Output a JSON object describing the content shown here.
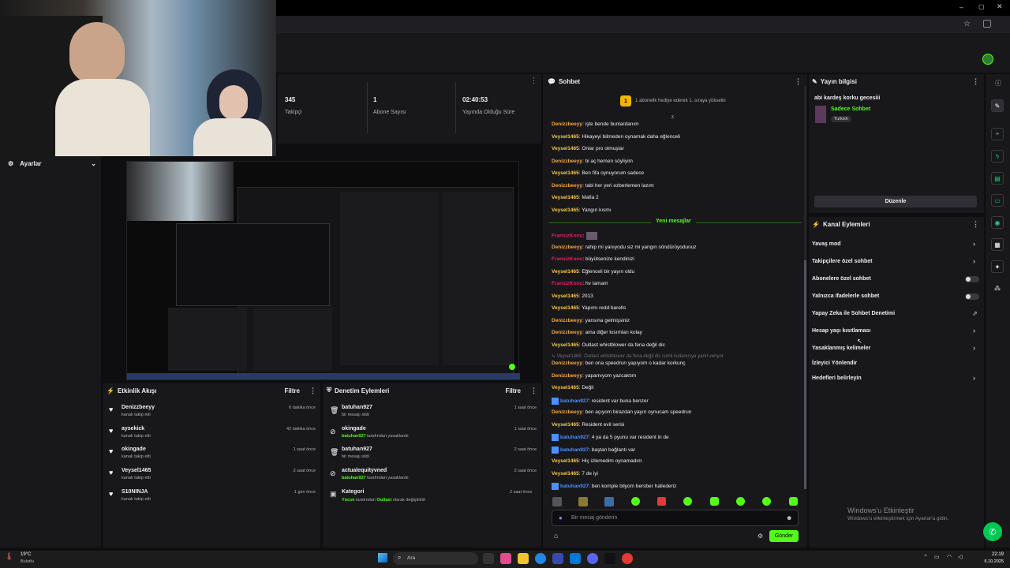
{
  "stats": [
    {
      "value": "345",
      "label": "Takipçi"
    },
    {
      "value": "1",
      "label": "Abone Sayısı"
    },
    {
      "value": "02:40:53",
      "label": "Yayında Olduğu Süre"
    }
  ],
  "left": {
    "settings": "Ayarlar"
  },
  "chat": {
    "title": "Sohbet",
    "goal_badge": "1",
    "goal_text": "1 abonelik hediye ederek 1. sıraya yükselin",
    "new_messages": "Yeni mesajlar",
    "input_placeholder": "Bir mesaj gönderin",
    "send": "Gönder",
    "messages": [
      {
        "user": "Denizzbeeyy",
        "color": "o",
        "text": ": işte bende bunlardanım"
      },
      {
        "user": "Veysel1465",
        "color": "y",
        "text": ": Hikayeyi bilmeden oynamak daha eğlenceli"
      },
      {
        "user": "Veysel1465",
        "color": "y",
        "text": ": Onlar pro olmuşlar"
      },
      {
        "user": "Denizzbeeyy",
        "color": "o",
        "text": ": bi aç hemen söyliyim"
      },
      {
        "user": "Veysel1465",
        "color": "y",
        "text": ": Ben fifa oynuyorum sadece"
      },
      {
        "user": "Denizzbeeyy",
        "color": "o",
        "text": ": tabi her yeri ezberlemen lazım"
      },
      {
        "user": "Veysel1465",
        "color": "y",
        "text": ": Mafia 2"
      },
      {
        "user": "Veysel1465",
        "color": "y",
        "text": ": Yangın kısmı"
      }
    ],
    "messages2": [
      {
        "user": "FransizKonu",
        "color": "p",
        "text": ":"
      },
      {
        "user": "Denizzbeeyy",
        "color": "o",
        "text": ": rahip mi yanıyodu siz mi yangın söndürüyodunuz"
      },
      {
        "user": "FransizKonu",
        "color": "p",
        "text": ": büyütsenize kendinizi"
      },
      {
        "user": "Veysel1465",
        "color": "y",
        "text": ": Eğlenceli bir yayın oldu"
      },
      {
        "user": "FransizKonu",
        "color": "p",
        "text": ": hv tamam"
      },
      {
        "user": "Veysel1465",
        "color": "y",
        "text": ": 2013"
      },
      {
        "user": "Veysel1465",
        "color": "y",
        "text": ": Yapımı redd barells"
      },
      {
        "user": "Denizzbeeyy",
        "color": "o",
        "text": ": yansına gelmişsiniz"
      },
      {
        "user": "Denizzbeeyy",
        "color": "o",
        "text": ": ama diğer kısımları kolay"
      },
      {
        "user": "Veysel1465",
        "color": "y",
        "text": ": Outlast whistblower da fena değil dic"
      }
    ],
    "reply_note": "Veysel1465: Outlast whistblower da fena değil dic isimli kullanıcıya yanıt veriyor",
    "messages3": [
      {
        "user": "Denizzbeeyy",
        "color": "o",
        "text": ": ben ona speedrun yapıyom o kadar korkunç"
      },
      {
        "user": "Denizzbeeyy",
        "color": "o",
        "text": ": yapamıyom yazcaktım"
      },
      {
        "user": "Veysel1465",
        "color": "y",
        "text": ": Değil"
      },
      {
        "user": "batuhan927",
        "color": "b",
        "text": ": resident var buna benzer"
      },
      {
        "user": "Denizzbeeyy",
        "color": "o",
        "text": ": ben açıyom birazdan yayın oynucam speedrun"
      },
      {
        "user": "Veysel1465",
        "color": "y",
        "text": ": Resident evil serisi"
      },
      {
        "user": "batuhan927",
        "color": "b",
        "text": ": 4 ya da 5 pyunu var resident in de"
      },
      {
        "user": "batuhan927",
        "color": "b",
        "text": ": baştan bağlantı var"
      },
      {
        "user": "Veysel1465",
        "color": "y",
        "text": ": Hiç izlemedim oynamadım"
      },
      {
        "user": "Veysel1465",
        "color": "y",
        "text": ": 7 de iyi"
      },
      {
        "user": "batuhan927",
        "color": "b",
        "text": ": ben komple bilyom bersber hallederiz"
      }
    ]
  },
  "stream_info": {
    "title": "Yayın bilgisi",
    "stream_title": "abi kardeş korku gecesiii",
    "category": "Sadece Sohbet",
    "tag": "Turkish",
    "edit": "Düzenle"
  },
  "channel_actions": {
    "title": "Kanal Eylemleri",
    "items": [
      "Yavaş mod",
      "Takipçilere özel sohbet",
      "Abonelere özel sohbet",
      "Yalnızca ifadelerle sohbet",
      "Yapay Zeka ile Sohbet Denetimi",
      "Hesap yaşı kısıtlaması",
      "Yasaklanmış kelimeler",
      "İzleyici Yönlendir",
      "Hedefleri belirleyin"
    ]
  },
  "activity": {
    "title": "Etkinlik Akışı",
    "filter": "Filtre",
    "items": [
      {
        "name": "Denizzbeeyy",
        "sub": "kanalı takip etti",
        "time": "6 dakika önce"
      },
      {
        "name": "aysekick",
        "sub": "kanalı takip etti",
        "time": "42 dakika önce"
      },
      {
        "name": "okingade",
        "sub": "kanalı takip etti",
        "time": "1 saat önce"
      },
      {
        "name": "Veysel1465",
        "sub": "kanalı takip etti",
        "time": "2 saat önce"
      },
      {
        "name": "S10NINJA",
        "sub": "kanalı takip etti",
        "time": "1 gün önce"
      }
    ]
  },
  "moderation": {
    "title": "Denetim Eylemleri",
    "filter": "Filtre",
    "items": [
      {
        "name": "batuhan927",
        "sub": "bir mesajı sildi",
        "time": "1 saat önce",
        "actor": ""
      },
      {
        "name": "okingade",
        "sub": " tarafından yasaklandı",
        "time": "1 saat önce",
        "actor": "batuhan927"
      },
      {
        "name": "batuhan927",
        "sub": "bir mesajı sildi",
        "time": "2 saat önce",
        "actor": ""
      },
      {
        "name": "actualequityvned",
        "sub": " tarafından yasaklandı",
        "time": "2 saat önce",
        "actor": "batuhan927"
      }
    ],
    "category": {
      "name": "Kategori",
      "actor": "Yncsn",
      "mid": " tarafından ",
      "target": "Outlast",
      "end": " olarak değiştirildi",
      "time": "2 saat önce"
    }
  },
  "watermark": {
    "line1": "Windows'u Etkinleştir",
    "line2": "Windows'u etkinleştirmek için Ayarlar'a gidin."
  },
  "taskbar": {
    "weather_temp": "19°C",
    "weather_desc": "Bulutlu",
    "search": "Ara",
    "time": "22:19",
    "date": "6.10.2025"
  },
  "colors": {
    "accent": "#53fc18",
    "bg": "#0e0e10",
    "panel": "#18181b"
  }
}
